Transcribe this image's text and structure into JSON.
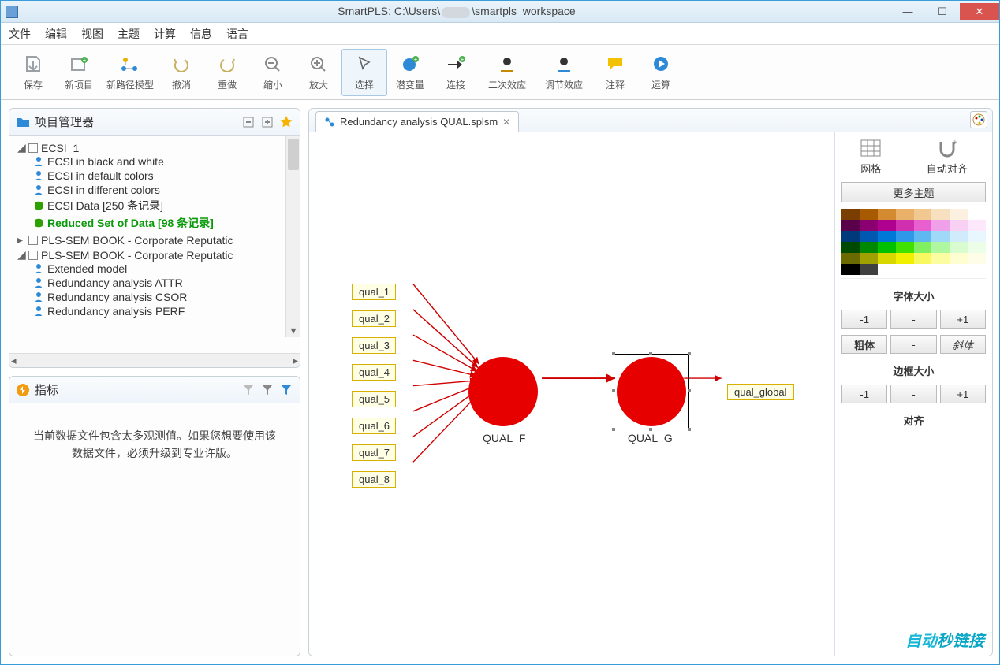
{
  "title_prefix": "SmartPLS: C:\\Users\\",
  "title_suffix": "\\smartpls_workspace",
  "menubar": [
    "文件",
    "编辑",
    "视图",
    "主题",
    "计算",
    "信息",
    "语言"
  ],
  "toolbar": {
    "save": "保存",
    "new_project": "新项目",
    "new_path_model": "新路径模型",
    "undo": "撤消",
    "redo": "重做",
    "zoom_out": "缩小",
    "zoom_in": "放大",
    "select": "选择",
    "latent": "潜变量",
    "connect": "连接",
    "quadratic": "二次效应",
    "moderation": "调节效应",
    "comment": "注释",
    "calculate": "运算"
  },
  "project": {
    "title": "项目管理器",
    "items": [
      {
        "label": "ECSI_1",
        "type": "folder",
        "expanded": true,
        "children": [
          {
            "label": "ECSI in black and white",
            "type": "model"
          },
          {
            "label": "ECSI in default colors",
            "type": "model"
          },
          {
            "label": "ECSI in different colors",
            "type": "model"
          },
          {
            "label": "ECSI Data [250 条记录]",
            "type": "data"
          },
          {
            "label": "Reduced Set of Data [98 条记录]",
            "type": "data",
            "highlight": true
          }
        ]
      },
      {
        "label": "PLS-SEM BOOK - Corporate Reputatic",
        "type": "folder",
        "expanded": false
      },
      {
        "label": "PLS-SEM BOOK - Corporate Reputatic",
        "type": "folder",
        "expanded": true,
        "children": [
          {
            "label": "Extended model",
            "type": "model"
          },
          {
            "label": "Redundancy analysis ATTR",
            "type": "model"
          },
          {
            "label": "Redundancy analysis CSOR",
            "type": "model"
          },
          {
            "label": "Redundancy analysis PERF",
            "type": "model"
          }
        ]
      }
    ]
  },
  "indicator_panel": {
    "title": "指标",
    "message": "当前数据文件包含太多观测值。如果您想要使用该数据文件，必须升级到专业许版。"
  },
  "tab": {
    "label": "Redundancy analysis QUAL.splsm"
  },
  "diagram": {
    "indicators_left": [
      "qual_1",
      "qual_2",
      "qual_3",
      "qual_4",
      "qual_5",
      "qual_6",
      "qual_7",
      "qual_8"
    ],
    "construct_left": "QUAL_F",
    "construct_right": "QUAL_G",
    "indicator_right": "qual_global"
  },
  "side": {
    "grid": "网格",
    "autoalign": "自动对齐",
    "more_themes": "更多主题",
    "font_size": "字体大小",
    "border_size": "边框大小",
    "align": "对齐",
    "minus1": "-1",
    "reset": "-",
    "plus1": "+1",
    "bold": "粗体",
    "italic": "斜体",
    "swatches": [
      "#7a3e00",
      "#a85a00",
      "#d48a30",
      "#e8b068",
      "#f0c890",
      "#f6e0c0",
      "#fcf0e0",
      "#ffffff",
      "#5a004a",
      "#8a0070",
      "#b00090",
      "#d030b0",
      "#e860d0",
      "#f0a0e8",
      "#f8d0f4",
      "#fce8fa",
      "#003a7a",
      "#0058b0",
      "#0078d8",
      "#3098e8",
      "#60b8f0",
      "#a0d8f8",
      "#d0ecfc",
      "#e8f6fe",
      "#004a00",
      "#008800",
      "#00c000",
      "#40e000",
      "#80f060",
      "#b0f8a0",
      "#d8fcd0",
      "#ecfee8",
      "#6a6a00",
      "#a0a000",
      "#d8d800",
      "#f0f000",
      "#f8f860",
      "#fcfca0",
      "#fefed0",
      "#fefee8",
      "#000000",
      "#404040",
      "#ffffff",
      "#ffffff",
      "#ffffff",
      "#ffffff",
      "#ffffff",
      "#ffffff"
    ]
  },
  "watermark": {
    "a": "自动",
    "b": "秒链接"
  }
}
